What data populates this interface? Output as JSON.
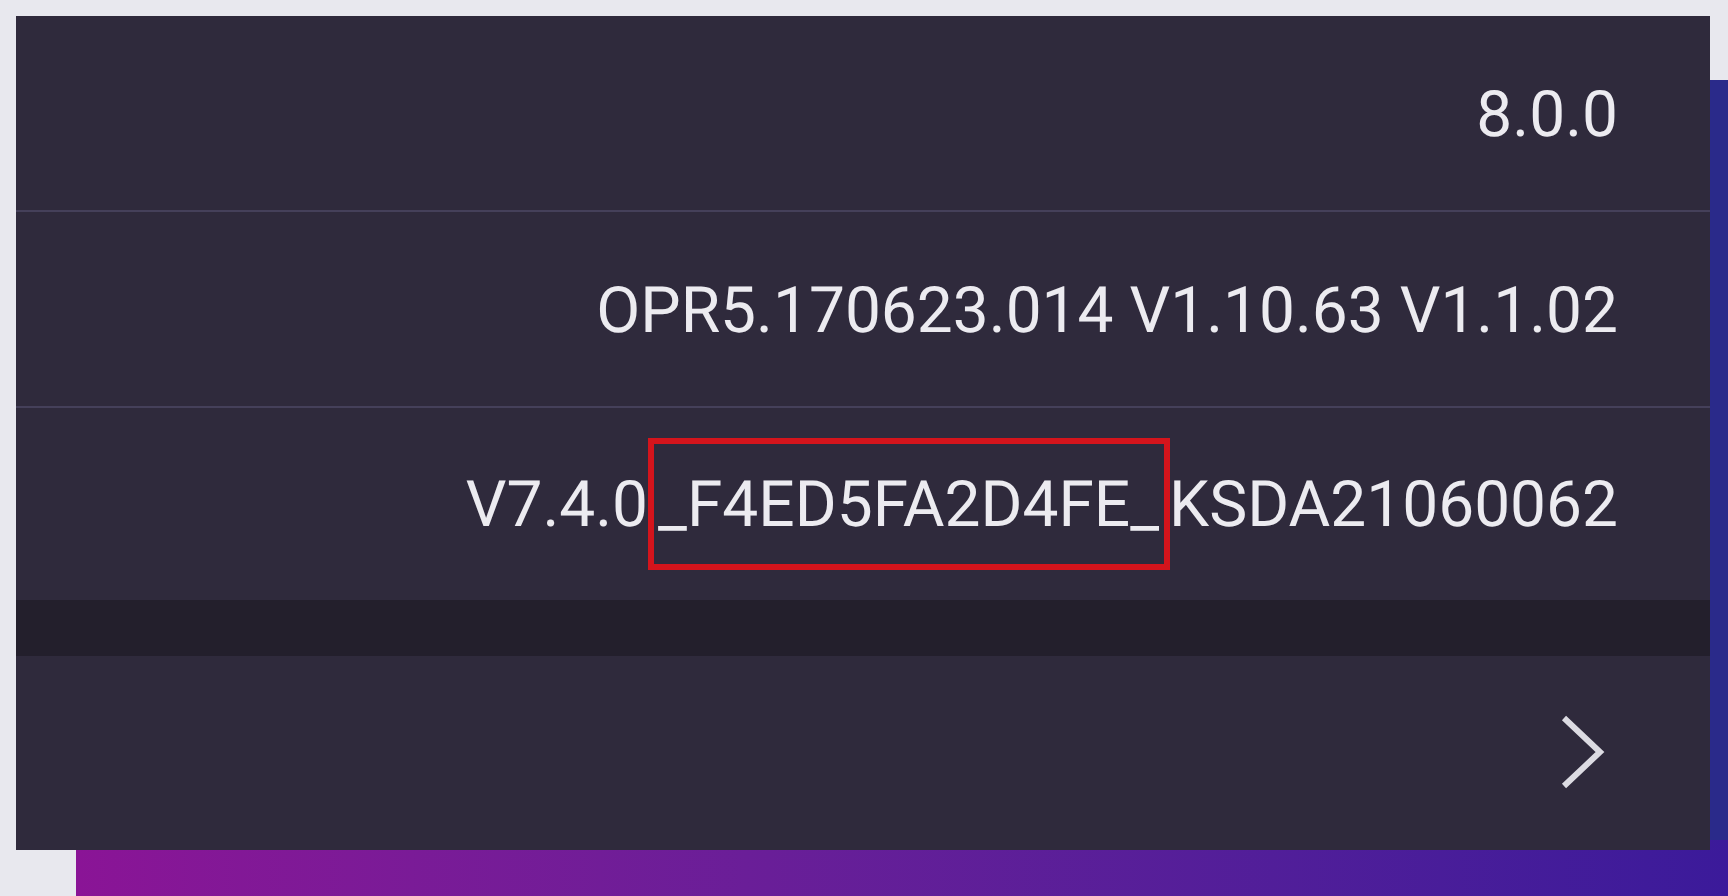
{
  "rows": [
    {
      "kind": "text",
      "value": "8.0.0"
    },
    {
      "kind": "text",
      "value": "OPR5.170623.014 V1.10.63 V1.1.02"
    },
    {
      "kind": "parts",
      "parts": [
        {
          "text": "V7.4.0",
          "highlighted": false
        },
        {
          "text": "_F4ED5FA2D4FE_",
          "highlighted": true
        },
        {
          "text": "KSDA21060062",
          "highlighted": false
        }
      ]
    },
    {
      "kind": "gap"
    },
    {
      "kind": "link"
    }
  ]
}
